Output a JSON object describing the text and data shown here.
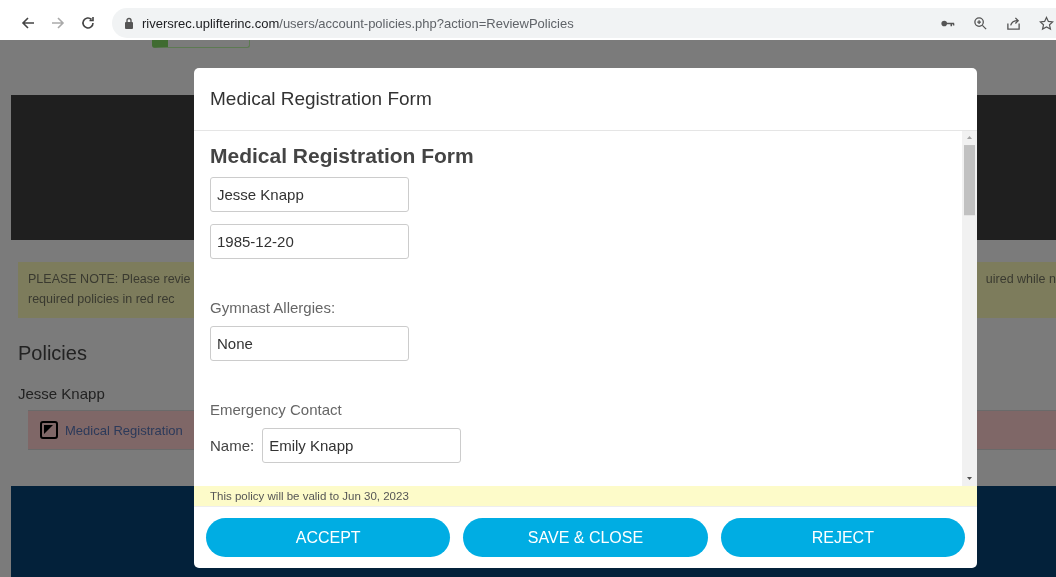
{
  "browser": {
    "url_host": "riversrec.uplifterinc.com",
    "url_path": "/users/account-policies.php?action=ReviewPolicies"
  },
  "page": {
    "note_left": [
      "PLEASE NOTE: Please revie",
      "required policies in red rec"
    ],
    "note_right": "uired while n",
    "heading": "Policies",
    "person": "Jesse Knapp",
    "policy_link": "Medical Registration"
  },
  "modal": {
    "title": "Medical Registration Form",
    "form_title": "Medical Registration Form",
    "fields": [
      {
        "kind": "input",
        "value": "Jesse Knapp"
      },
      {
        "kind": "input",
        "value": "1985-12-20"
      },
      {
        "kind": "label",
        "text": "Gymnast Allergies:"
      },
      {
        "kind": "input",
        "value": "None"
      },
      {
        "kind": "label",
        "text": "Emergency Contact"
      },
      {
        "kind": "labeled_input",
        "label": "Name:",
        "value": "Emily Knapp"
      }
    ],
    "valid_note": "This policy will be valid to Jun 30, 2023",
    "buttons": [
      "ACCEPT",
      "SAVE & CLOSE",
      "REJECT"
    ]
  }
}
